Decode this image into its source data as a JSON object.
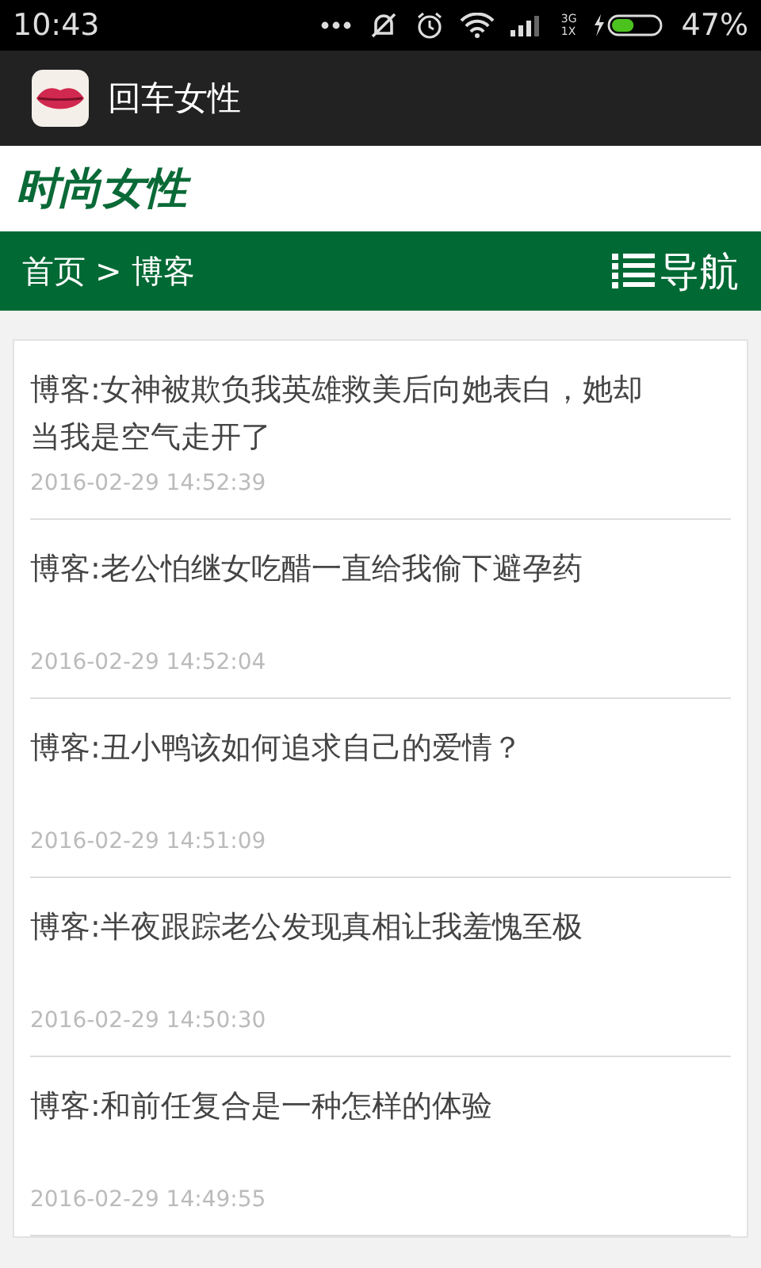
{
  "status_bar": {
    "time": "10:43",
    "network_top": "3G",
    "network_bottom": "1X",
    "battery": {
      "label": "47%",
      "level": 0.47
    }
  },
  "app_bar": {
    "title": "回车女性"
  },
  "site": {
    "title": "时尚女性"
  },
  "breadcrumb": {
    "items": [
      "首页",
      "博客"
    ],
    "separator": ">",
    "nav_label": "导航"
  },
  "posts": [
    {
      "title": "博客:女神被欺负我英雄救美后向她表白，她却当我是空气走开了",
      "date": "2016-02-29 14:52:39"
    },
    {
      "title": "博客:老公怕继女吃醋一直给我偷下避孕药",
      "date": "2016-02-29 14:52:04"
    },
    {
      "title": "博客:丑小鸭该如何追求自己的爱情？",
      "date": "2016-02-29 14:51:09"
    },
    {
      "title": "博客:半夜跟踪老公发现真相让我羞愧至极",
      "date": "2016-02-29 14:50:30"
    },
    {
      "title": "博客:和前任复合是一种怎样的体验",
      "date": "2016-02-29 14:49:55"
    }
  ]
}
